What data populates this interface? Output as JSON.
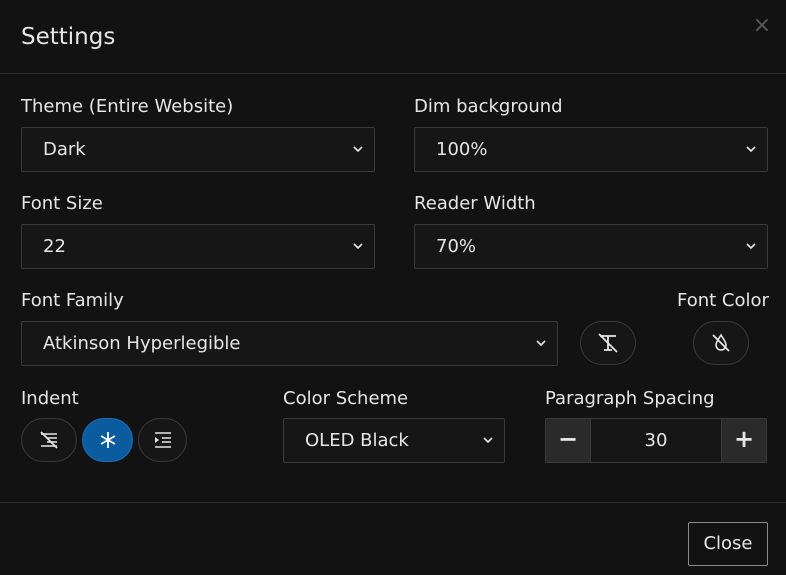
{
  "dialog": {
    "title": "Settings",
    "close_icon": "×",
    "close_button_label": "Close"
  },
  "theme": {
    "label": "Theme (Entire Website)",
    "value": "Dark"
  },
  "dim_background": {
    "label": "Dim background",
    "value": "100%"
  },
  "font_size": {
    "label": "Font Size",
    "value": "22"
  },
  "reader_width": {
    "label": "Reader Width",
    "value": "70%"
  },
  "font_family": {
    "label": "Font Family",
    "value": "Atkinson Hyperlegible",
    "reset_icon": "text-style-off-icon"
  },
  "font_color": {
    "label": "Font Color",
    "reset_icon": "color-drop-off-icon"
  },
  "indent": {
    "label": "Indent",
    "options": [
      {
        "icon": "indent-off-icon",
        "active": false
      },
      {
        "icon": "asterisk-icon",
        "active": true
      },
      {
        "icon": "indent-increase-icon",
        "active": false
      }
    ]
  },
  "color_scheme": {
    "label": "Color Scheme",
    "value": "OLED Black"
  },
  "paragraph_spacing": {
    "label": "Paragraph Spacing",
    "value": "30",
    "decrement": "−",
    "increment": "+"
  },
  "colors": {
    "background": "#121212",
    "border": "#3a3a3a",
    "accent": "#0b5c9e",
    "text": "#e6e6e6"
  }
}
